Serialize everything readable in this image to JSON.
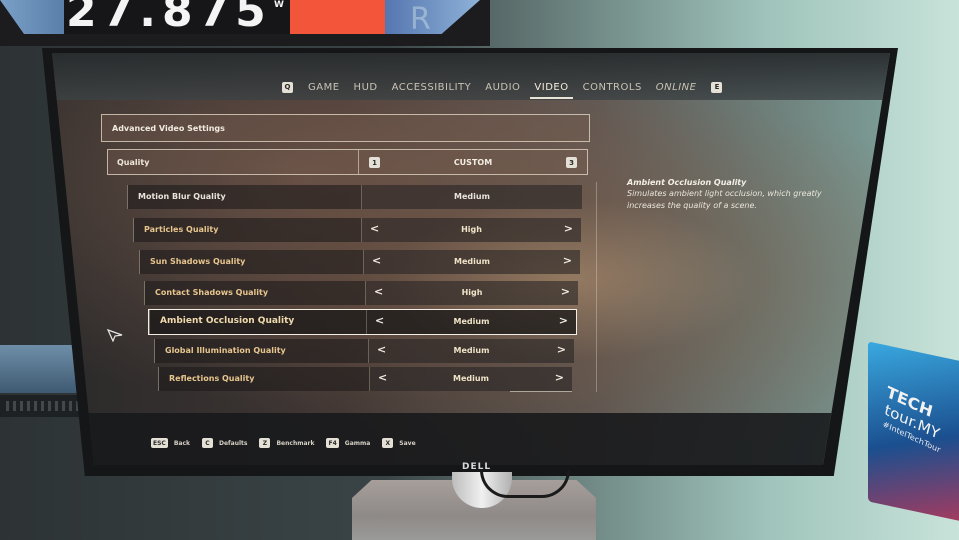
{
  "background_monitor": {
    "reading": "27.875",
    "unit": "W",
    "letter": "R"
  },
  "navigation": {
    "prev_key": "Q",
    "next_key": "E",
    "tabs": [
      {
        "label": "GAME",
        "active": false
      },
      {
        "label": "HUD",
        "active": false
      },
      {
        "label": "ACCESSIBILITY",
        "active": false
      },
      {
        "label": "AUDIO",
        "active": false
      },
      {
        "label": "VIDEO",
        "active": true
      },
      {
        "label": "CONTROLS",
        "active": false
      },
      {
        "label": "ONLINE",
        "active": false
      }
    ]
  },
  "section_header": "Advanced Video Settings",
  "quality": {
    "label": "Quality",
    "prev_key": "1",
    "next_key": "3",
    "value": "CUSTOM"
  },
  "settings": [
    {
      "name": "Motion Blur Quality",
      "value": "Medium",
      "has_arrows": false,
      "selected": false
    },
    {
      "name": "Particles Quality",
      "value": "High",
      "has_arrows": true,
      "selected": false
    },
    {
      "name": "Sun Shadows Quality",
      "value": "Medium",
      "has_arrows": true,
      "selected": false
    },
    {
      "name": "Contact Shadows Quality",
      "value": "High",
      "has_arrows": true,
      "selected": false
    },
    {
      "name": "Ambient Occlusion Quality",
      "value": "Medium",
      "has_arrows": true,
      "selected": true
    },
    {
      "name": "Global Illumination Quality",
      "value": "Medium",
      "has_arrows": true,
      "selected": false
    },
    {
      "name": "Reflections Quality",
      "value": "Medium",
      "has_arrows": true,
      "selected": false
    }
  ],
  "arrows": {
    "left": "<",
    "right": ">"
  },
  "description": {
    "title": "Ambient Occlusion Quality",
    "body": "Simulates ambient light occlusion, which greatly increases the quality of a scene."
  },
  "hints": [
    {
      "key": "ESC",
      "label": "Back"
    },
    {
      "key": "C",
      "label": "Defaults"
    },
    {
      "key": "Z",
      "label": "Benchmark"
    },
    {
      "key": "F4",
      "label": "Gamma"
    },
    {
      "key": "X",
      "label": "Save"
    }
  ],
  "monitor_brand": "DELL",
  "box_label": {
    "line1": "TECH",
    "line2": "tour.MY",
    "line3": "#IntelTechTour"
  }
}
